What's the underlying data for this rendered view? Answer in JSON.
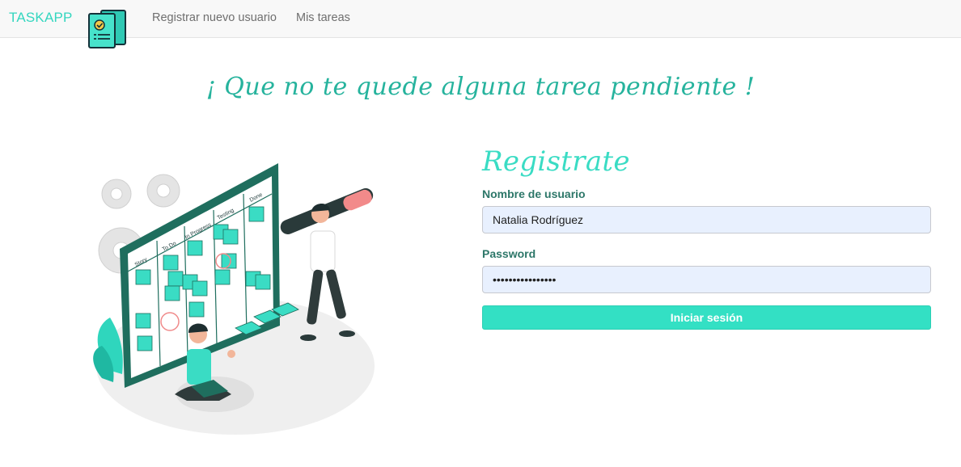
{
  "nav": {
    "brand": "TASKAPP",
    "logo_icon": "task-clipboard-icon",
    "links": [
      "Registrar nuevo usuario",
      "Mis tareas"
    ]
  },
  "tagline": "¡ Que no te quede alguna tarea pendiente !",
  "hero": {
    "icon": "kanban-board-illustration",
    "columns": [
      "Story",
      "To Do",
      "In Progress",
      "Testing",
      "Done"
    ]
  },
  "form": {
    "title": "Registrate",
    "username_label": "Nombre de usuario",
    "username_value": "Natalia Rodríguez",
    "password_label": "Password",
    "password_value": "••••••••••••••••",
    "submit_label": "Iniciar sesión"
  },
  "colors": {
    "accent": "#33d6bf",
    "tagline": "#26b39d",
    "label": "#2d7769",
    "button": "#33e0c4",
    "board": "#1f6e5e"
  }
}
